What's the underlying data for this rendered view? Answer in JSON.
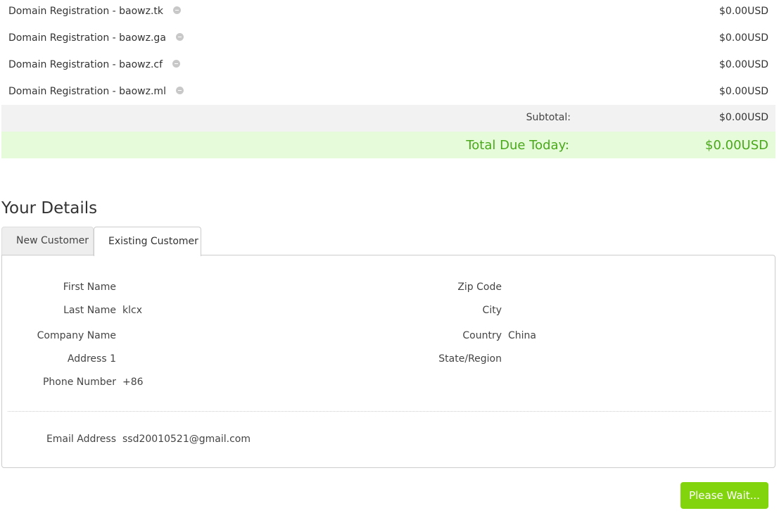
{
  "order": {
    "items": [
      {
        "description": "Domain Registration - baowz.tk",
        "price": "$0.00USD"
      },
      {
        "description": "Domain Registration - baowz.ga",
        "price": "$0.00USD"
      },
      {
        "description": "Domain Registration - baowz.cf",
        "price": "$0.00USD"
      },
      {
        "description": "Domain Registration - baowz.ml",
        "price": "$0.00USD"
      }
    ],
    "subtotal_label": "Subtotal:",
    "subtotal_value": "$0.00USD",
    "total_label": "Total Due Today:",
    "total_value": "$0.00USD"
  },
  "details": {
    "title": "Your Details",
    "tabs": {
      "new_customer": "New Customer",
      "existing_customer": "Existing Customer",
      "active": "existing_customer"
    },
    "fields": {
      "first_name": {
        "label": "First Name",
        "value": ""
      },
      "last_name": {
        "label": "Last Name",
        "value": "klcx"
      },
      "company_name": {
        "label": "Company Name",
        "value": ""
      },
      "address1": {
        "label": "Address 1",
        "value": ""
      },
      "phone_number": {
        "label": "Phone Number",
        "value": "+86"
      },
      "zip_code": {
        "label": "Zip Code",
        "value": ""
      },
      "city": {
        "label": "City",
        "value": ""
      },
      "country": {
        "label": "Country",
        "value": "China"
      },
      "state_region": {
        "label": "State/Region",
        "value": ""
      },
      "email_address": {
        "label": "Email Address",
        "value": "ssd20010521@gmail.com"
      }
    }
  },
  "actions": {
    "submit_label": "Please Wait..."
  },
  "colors": {
    "total_text": "#4aa81b",
    "total_background": "#e6fbd9",
    "button_background": "#82d40d",
    "subtotal_background": "#f2f2f2"
  },
  "icons": {
    "remove": "minus-circle-icon"
  }
}
